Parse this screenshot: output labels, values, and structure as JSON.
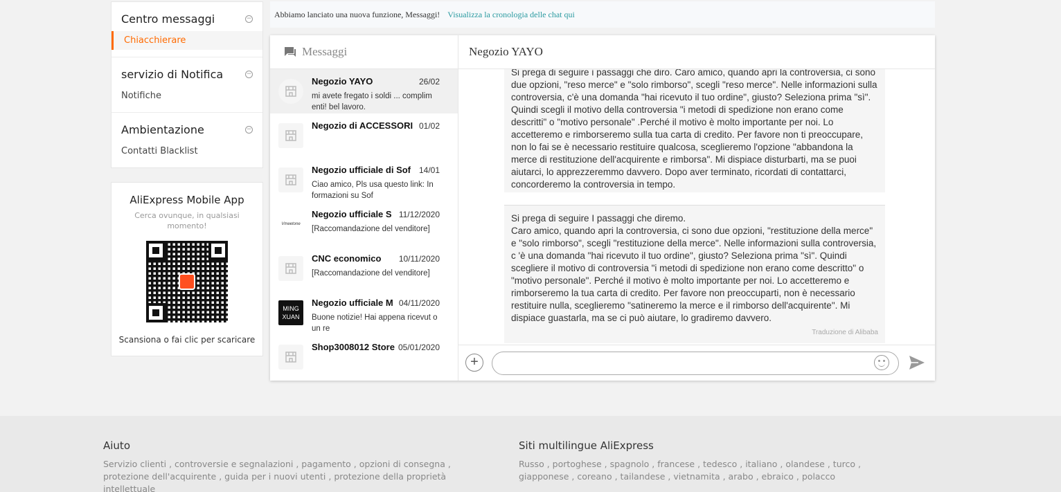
{
  "sidebar": {
    "sections": [
      {
        "title": "Centro messaggi",
        "items": [
          "Chiacchierare"
        ]
      },
      {
        "title": "servizio di Notifica",
        "items": [
          "Notifiche"
        ]
      },
      {
        "title": "Ambientazione",
        "items": [
          "Contatti Blacklist"
        ]
      }
    ],
    "app": {
      "title": "AliExpress Mobile App",
      "subtitle": "Cerca ovunque, in qualsiasi momento!",
      "scan": "Scansiona o fai clic per scaricare"
    }
  },
  "banner": {
    "text": "Abbiamo lanciato una nuova funzione, Messaggi!",
    "link": "Visualizza la cronologia delle chat qui"
  },
  "conversations": {
    "header": "Messaggi",
    "items": [
      {
        "name": "Negozio YAYO",
        "date": "26/02",
        "preview": "mi avete fregato i soldi ... complim enti! bel lavoro."
      },
      {
        "name": "Negozio di ACCESSORI",
        "date": "01/02",
        "preview": ""
      },
      {
        "name": "Negozio ufficiale di Sof",
        "date": "14/01",
        "preview": "Ciao amico, Pls usa questo link: In formazioni su Sof"
      },
      {
        "name": "Negozio ufficiale S",
        "date": "11/12/2020",
        "preview": "[Raccomandazione del venditore]",
        "avatar_text": "Vmeetone"
      },
      {
        "name": "CNC economico",
        "date": "10/11/2020",
        "preview": "[Raccomandazione del venditore]"
      },
      {
        "name": "Negozio ufficiale M",
        "date": "04/11/2020",
        "preview": "Buone notizie! Hai appena ricevut o un re",
        "avatar_text": "MING XUAN"
      },
      {
        "name": "Shop3008012 Store",
        "date": "05/01/2020",
        "preview": ""
      }
    ]
  },
  "chat": {
    "title": "Negozio YAYO",
    "message1": "Si prega di seguire i passaggi che diro. Caro amico, quando apri la controversia, ci sono due opzioni, \"reso merce\" e \"solo rimborso\", scegli \"reso merce\". Nelle informazioni sulla controversia, c'è una domanda \"hai ricevuto il tuo ordine\", giusto? Seleziona prima \"sì\". Quindi scegli il motivo della controversia \"i metodi di spedizione non erano come descritti\" o \"motivo personale\" .Perché il motivo è molto importante per noi. Lo accetteremo e rimborseremo sulla tua carta di credito. Per favore non ti preoccupare, non lo fai se è necessario restituire qualcosa, sceglieremo l'opzione \"abbandona la merce di restituzione dell'acquirente e rimborsa\". Mi dispiace disturbarti, ma se puoi aiutarci, lo apprezzeremmo davvero. Dopo aver terminato, ricordati di contattarci, concorderemo la controversia in tempo.",
    "message2_line1": "Si prega di seguire I passaggi che diremo.",
    "message2_body": "Caro amico, quando apri la controversia, ci sono due opzioni, \"restituzione della merce\" e \"solo rimborso\", scegli \"restituzione della merce\". Nelle informazioni sulla controversia, c 'è una domanda \"hai ricevuto il tuo ordine\", giusto? Seleziona prima \"sì\". Quindi scegliere il motivo di controversia \"i metodi di spedizione non erano come descritto\" o \"motivo personale\". Perché il motivo è molto importante per noi. Lo accetteremo e rimborseremo la tua carta di credito. Per favore non preoccuparti, non è necessario restituire nulla, sceglieremo \"satineremo la merce e il rimborso dell'acquirente\". Mi dispiace guastarla, ma se ci può aiutare, lo gradiremo davvero.",
    "translation": "Traduzione di Alibaba"
  },
  "footer": {
    "help_title": "Aiuto",
    "help_links": "Servizio clienti , controversie e segnalazioni , pagamento , opzioni di consegna , protezione dell'acquirente , guida per i nuovi utenti , protezione della proprietà intellettuale",
    "sites_title": "Siti multilingue AliExpress",
    "sites_links": "Russo , portoghese , spagnolo , francese , tedesco , italiano , olandese , turco , giapponese , coreano , tailandese , vietnamita , arabo , ebraico , polacco"
  },
  "colors": {
    "accent": "#ff6a00",
    "link": "#2a9aa0"
  },
  "icons": [
    "minus-circle-icon",
    "chat-bubble-icon",
    "shop-icon",
    "plus-icon",
    "emoji-icon",
    "send-icon"
  ]
}
